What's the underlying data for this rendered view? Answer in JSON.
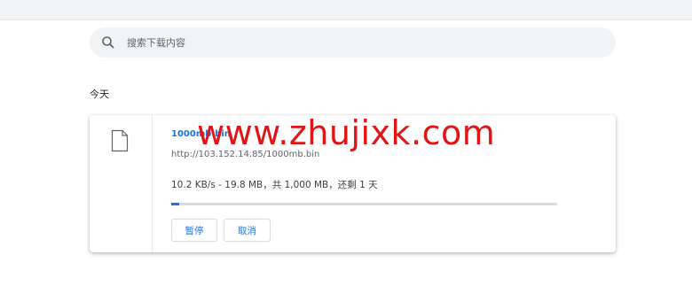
{
  "search": {
    "placeholder": "搜索下载内容",
    "icon": "search-icon"
  },
  "section": {
    "date_label": "今天"
  },
  "download": {
    "filename": "1000mb.bin",
    "url": "http://103.152.14.85/1000mb.bin",
    "status": "10.2 KB/s - 19.8 MB，共 1,000 MB，还剩 1 天",
    "progress_fraction": 0.0198,
    "file_icon": "file-icon",
    "pause_label": "暂停",
    "cancel_label": "取消"
  },
  "watermark": {
    "text": "www.zhujixk.com"
  },
  "colors": {
    "accent": "#1a73e8",
    "watermark": "#e11515",
    "search_bg": "#f1f3f4"
  }
}
